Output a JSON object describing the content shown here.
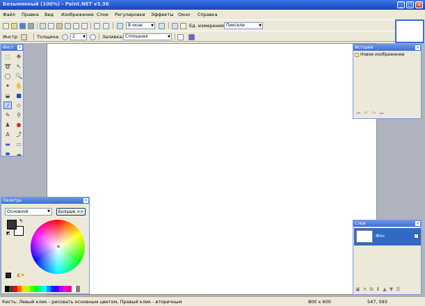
{
  "window": {
    "title": "Безымянный (100%) - Paint.NET v3.36"
  },
  "menu": [
    "Файл",
    "Правка",
    "Вид",
    "Изображение",
    "Слои",
    "Регулировки",
    "Эффекты",
    "Окно",
    "Справка"
  ],
  "toolbar1": {
    "zoom_value": "В окне",
    "units_label": "Ед. измерения:",
    "units_value": "Пиксели"
  },
  "toolbar2": {
    "tool_label": "Инстр:",
    "thickness_label": "Толщина:",
    "thickness_value": "2",
    "fill_label": "Заливка:",
    "fill_value": "Сплошная"
  },
  "tools_panel": {
    "title": "Инст"
  },
  "history_panel": {
    "title": "История",
    "items": [
      "Новое изображение"
    ]
  },
  "palette_panel": {
    "title": "Палитра",
    "mode_value": "Основной",
    "more_button": "Больше >>",
    "primary_color": "#333333",
    "secondary_color": "#ffffff"
  },
  "layers_panel": {
    "title": "Слои",
    "layers": [
      {
        "name": "Фон",
        "visible": true
      }
    ]
  },
  "status": {
    "message": "Кисть: Левый клик - рисовать основным цветом, Правый клик - вторичным",
    "image_size": "800 x 600",
    "cursor_pos": "547, 593"
  },
  "colors": {
    "accent": "#316ac5",
    "titlebar": "#2456cf",
    "panel_border": "#7a96df"
  }
}
